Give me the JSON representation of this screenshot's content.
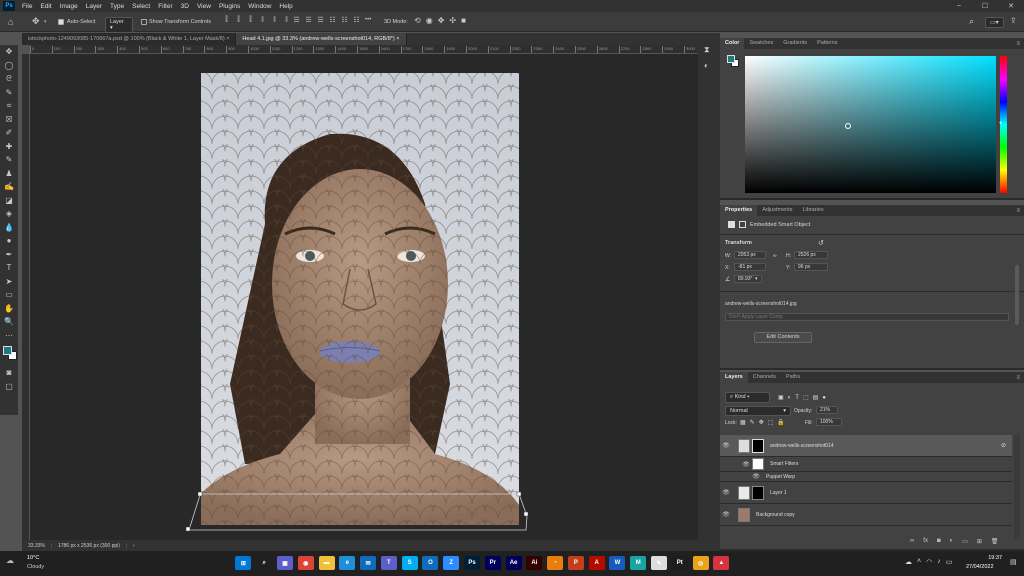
{
  "app": {
    "logo": "Ps"
  },
  "menubar": {
    "items": [
      "File",
      "Edit",
      "Image",
      "Layer",
      "Type",
      "Select",
      "Filter",
      "3D",
      "View",
      "Plugins",
      "Window",
      "Help"
    ],
    "window_controls": {
      "minimize": "–",
      "maximize": "☐",
      "close": "✕"
    }
  },
  "options_bar": {
    "auto_select_label": "Auto-Select",
    "auto_select_checked": true,
    "auto_select_target": "Layer",
    "show_transform_label": "Show Transform Controls",
    "mode_3d_label": "3D Mode:",
    "more_label": "•••"
  },
  "document_tabs": [
    {
      "label": "istockphoto-1249093085-170667a.psd @ 100% (Black & White 1, Layer Mask/8)",
      "close": "×",
      "active": false
    },
    {
      "label": "Head 4.1.jpg @ 33.3% (andrew-wells-screenshot014, RGB/8*)",
      "close": "×",
      "active": true
    }
  ],
  "ruler": {
    "ticks": [
      "0",
      "100",
      "200",
      "300",
      "400",
      "500",
      "600",
      "700",
      "800",
      "900",
      "1000",
      "1100",
      "1200",
      "1300",
      "1400",
      "1500",
      "1600",
      "1700",
      "1800",
      "1900",
      "2000",
      "2100",
      "2200",
      "2300",
      "2400",
      "2500",
      "2600",
      "2700",
      "2800",
      "2900",
      "3000",
      "3100"
    ]
  },
  "status_bar": {
    "zoom": "33.33%",
    "doc_size": "1786 px x 2536 px (300 ppi)",
    "arrow": "›"
  },
  "color_panel": {
    "tabs": [
      "Color",
      "Swatches",
      "Gradients",
      "Patterns"
    ],
    "hue_color": "#00e0ff",
    "foreground": "#1d7a80",
    "background": "#ffffff"
  },
  "properties_panel": {
    "tabs": [
      "Properties",
      "Adjustments",
      "Libraries"
    ],
    "type_label": "Embedded Smart Object",
    "transform_heading": "Transform",
    "w_label": "W:",
    "w_value": "2053 px",
    "h_label": "H:",
    "h_value": "2526 px",
    "x_label": "X:",
    "x_value": "-81 px",
    "y_label": "Y:",
    "y_value": "96 px",
    "angle_value": "89.93°",
    "filename": "andrew-wells-screenshot014.jpg",
    "layer_comp_placeholder": "Don't Apply Layer Comp",
    "edit_contents_label": "Edit Contents"
  },
  "layers_panel": {
    "tabs": [
      "Layers",
      "Channels",
      "Paths"
    ],
    "filter_kind": "Kind",
    "blend_mode": "Normal",
    "opacity_label": "Opacity:",
    "opacity_value": "21%",
    "lock_label": "Lock:",
    "fill_label": "Fill:",
    "fill_value": "100%",
    "layers": [
      {
        "name": "andrew-wells-screenshot014",
        "selected": true
      },
      {
        "name": "Smart Filters",
        "selected": false
      },
      {
        "name": "Puppet Warp",
        "selected": false
      },
      {
        "name": "Layer 1",
        "selected": false
      },
      {
        "name": "Background copy",
        "selected": false
      }
    ],
    "footer_icons": [
      "link-icon",
      "fx-icon",
      "mask-icon",
      "adjustment-icon",
      "group-icon",
      "new-layer-icon",
      "trash-icon"
    ]
  },
  "taskbar": {
    "weather_temp": "10°C",
    "weather_desc": "Cloudy",
    "time": "19:37",
    "date": "27/04/2022",
    "apps": [
      {
        "name": "windows-start",
        "label": "⊞",
        "color": "#0078d4"
      },
      {
        "name": "search",
        "label": "⌕",
        "color": "#202020"
      },
      {
        "name": "teams-chat",
        "label": "▣",
        "color": "#5b5fc7"
      },
      {
        "name": "chrome",
        "label": "◉",
        "color": "#db4437"
      },
      {
        "name": "file-explorer",
        "label": "▬",
        "color": "#f0c03c"
      },
      {
        "name": "edge",
        "label": "e",
        "color": "#1f8fd9"
      },
      {
        "name": "mail",
        "label": "✉",
        "color": "#0f6cbd"
      },
      {
        "name": "teams",
        "label": "T",
        "color": "#5b5fc7"
      },
      {
        "name": "skype",
        "label": "S",
        "color": "#00aff0"
      },
      {
        "name": "outlook",
        "label": "O",
        "color": "#0f6cbd"
      },
      {
        "name": "zoom",
        "label": "Z",
        "color": "#2d8cff"
      },
      {
        "name": "photoshop",
        "label": "Ps",
        "color": "#001e36"
      },
      {
        "name": "premiere",
        "label": "Pr",
        "color": "#00005b"
      },
      {
        "name": "after-effects",
        "label": "Ae",
        "color": "#00005b"
      },
      {
        "name": "illustrator",
        "label": "Ai",
        "color": "#330000"
      },
      {
        "name": "blender",
        "label": "◔",
        "color": "#e87d0d"
      },
      {
        "name": "powerpoint",
        "label": "P",
        "color": "#c43e1c"
      },
      {
        "name": "acrobat",
        "label": "A",
        "color": "#b30b00"
      },
      {
        "name": "word",
        "label": "W",
        "color": "#185abd"
      },
      {
        "name": "maya",
        "label": "M",
        "color": "#1aa3a3"
      },
      {
        "name": "inkscape",
        "label": "✎",
        "color": "#dddddd"
      },
      {
        "name": "pycharm",
        "label": "Pt",
        "color": "#1d1d1d"
      },
      {
        "name": "keyshot",
        "label": "◎",
        "color": "#e8a317"
      },
      {
        "name": "other-app",
        "label": "▲",
        "color": "#d4333f"
      }
    ]
  }
}
